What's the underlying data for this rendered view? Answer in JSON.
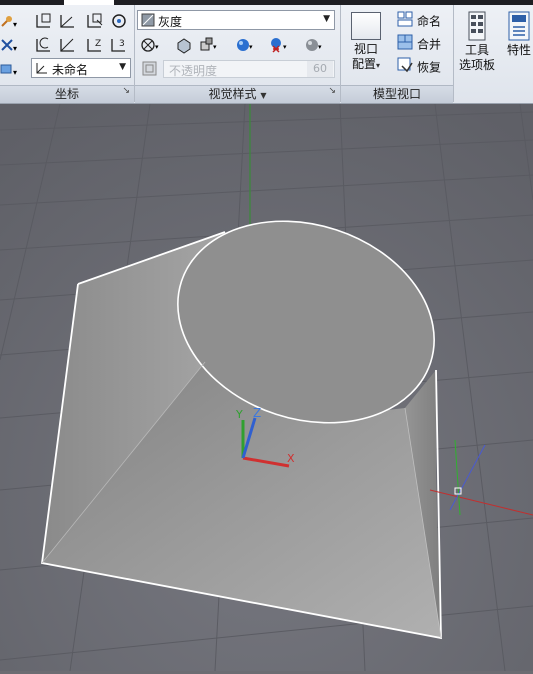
{
  "ribbon": {
    "coord_panel": {
      "title": "坐标",
      "ucs_name": "未命名"
    },
    "visual_styles_panel": {
      "title": "视觉样式",
      "style_name": "灰度",
      "opacity_label": "不透明度",
      "opacity_value": "60"
    },
    "model_viewports_panel": {
      "title": "模型视口",
      "config_label_1": "视口",
      "config_label_2": "配置",
      "name_label": "命名",
      "merge_label": "合并",
      "restore_label": "恢复"
    },
    "palettes": {
      "tools_label_1": "工具",
      "tools_label_2": "选项板",
      "properties_label": "特性"
    }
  },
  "viewport": {
    "ucs_axes": [
      "X",
      "Y",
      "Z"
    ],
    "object": "cylinder-cut-solid",
    "colors": {
      "background": "#6b6c72",
      "grid": "#5a5b61",
      "highlight": "#ffffff"
    }
  }
}
